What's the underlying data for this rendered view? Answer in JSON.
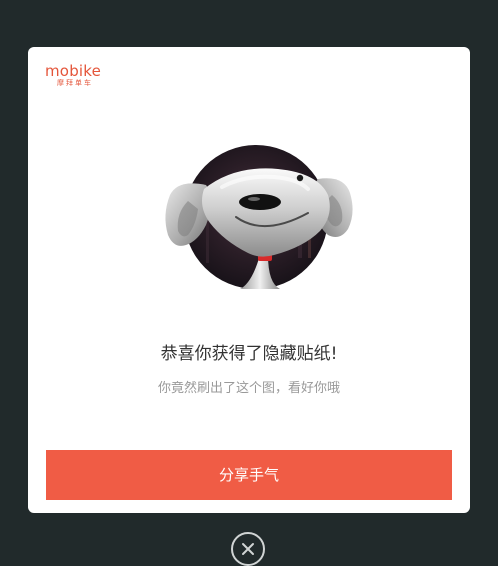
{
  "dialog": {
    "logo": {
      "word": "mobike",
      "tagline": "摩拜单车"
    },
    "sticker": {
      "icon": "joy-dog-mascot-icon"
    },
    "title": "恭喜你获得了隐藏贴纸!",
    "subtitle": "你竟然刷出了这个图，看好你哦",
    "share_button_label": "分享手气",
    "close_icon": "close-icon"
  },
  "colors": {
    "overlay": "#212a2b",
    "accent": "#f05c45",
    "brand": "#e4553a",
    "title_text": "#333333",
    "subtitle_text": "#999999"
  }
}
